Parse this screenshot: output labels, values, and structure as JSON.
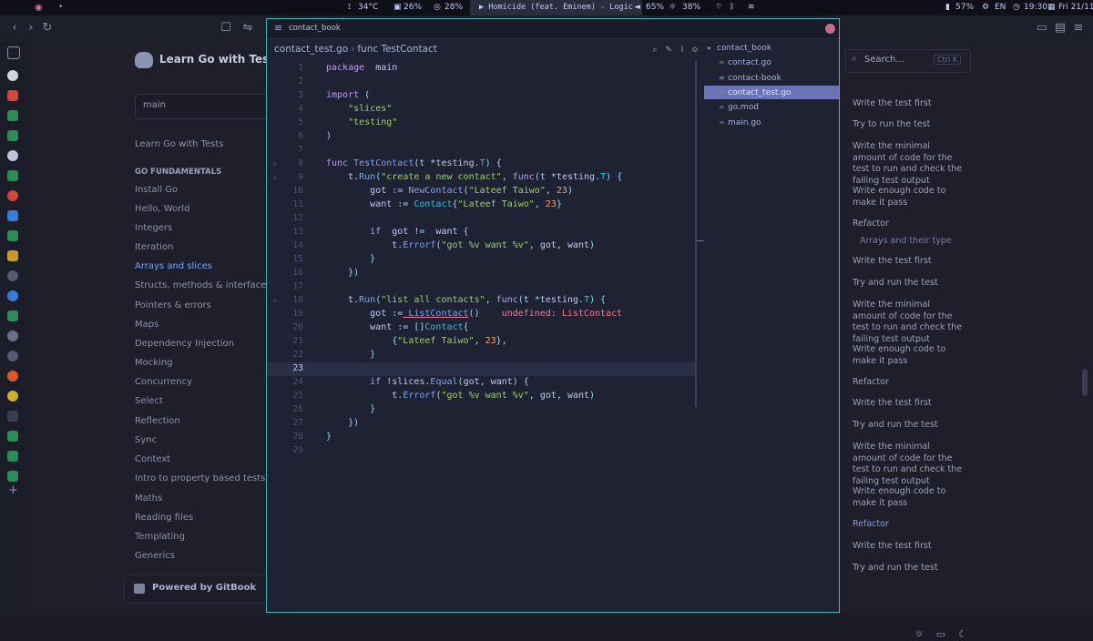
{
  "topbar": {
    "temperature": "34°C",
    "cpu": "26%",
    "memory": "28%",
    "now_playing": "▶ Homicide (feat. Eminem) - Logic",
    "volume": "65%",
    "brightness": "38%",
    "battery": "57%",
    "language": "EN",
    "time": "19:30",
    "date": "Fri 21/11"
  },
  "gitbook": {
    "site_title": "Learn Go with Tests",
    "search_value": "main",
    "nav": [
      {
        "label": "Learn Go with Tests",
        "kind": "item"
      },
      {
        "label": "GO FUNDAMENTALS",
        "kind": "section"
      },
      {
        "label": "Install Go",
        "kind": "item"
      },
      {
        "label": "Hello, World",
        "kind": "item"
      },
      {
        "label": "Integers",
        "kind": "item"
      },
      {
        "label": "Iteration",
        "kind": "item"
      },
      {
        "label": "Arrays and slices",
        "kind": "active"
      },
      {
        "label": "Structs, methods & interfaces",
        "kind": "item"
      },
      {
        "label": "Pointers & errors",
        "kind": "item"
      },
      {
        "label": "Maps",
        "kind": "item"
      },
      {
        "label": "Dependency Injection",
        "kind": "item"
      },
      {
        "label": "Mocking",
        "kind": "item"
      },
      {
        "label": "Concurrency",
        "kind": "item"
      },
      {
        "label": "Select",
        "kind": "item"
      },
      {
        "label": "Reflection",
        "kind": "item"
      },
      {
        "label": "Sync",
        "kind": "item"
      },
      {
        "label": "Context",
        "kind": "item"
      },
      {
        "label": "Intro to property based tests",
        "kind": "item"
      },
      {
        "label": "Maths",
        "kind": "item"
      },
      {
        "label": "Reading files",
        "kind": "item"
      },
      {
        "label": "Templating",
        "kind": "item"
      },
      {
        "label": "Generics",
        "kind": "item"
      }
    ],
    "powered_by": "Powered by GitBook",
    "toc_search_placeholder": "Search...",
    "toc_search_shortcut": "Ctrl K",
    "toc": [
      {
        "label": "Write the test first",
        "kind": "item"
      },
      {
        "label": "Try to run the test",
        "kind": "item"
      },
      {
        "label": "Write the minimal amount of code for the test to run and check the failing test output",
        "kind": "item"
      },
      {
        "label": "Write enough code to make it pass",
        "kind": "item"
      },
      {
        "label": "Refactor",
        "kind": "item"
      },
      {
        "label": "Arrays and their type",
        "kind": "sub"
      },
      {
        "label": "Write the test first",
        "kind": "item"
      },
      {
        "label": "Try and run the test",
        "kind": "item"
      },
      {
        "label": "Write the minimal amount of code for the test to run and check the failing test output",
        "kind": "item"
      },
      {
        "label": "Write enough code to make it pass",
        "kind": "item"
      },
      {
        "label": "Refactor",
        "kind": "item"
      },
      {
        "label": "Write the test first",
        "kind": "item"
      },
      {
        "label": "Try and run the test",
        "kind": "item"
      },
      {
        "label": "Write the minimal amount of code for the test to run and check the failing test output",
        "kind": "item"
      },
      {
        "label": "Write enough code to make it pass",
        "kind": "item"
      },
      {
        "label": "Refactor",
        "kind": "active"
      },
      {
        "label": "Write the test first",
        "kind": "item"
      },
      {
        "label": "Try and run the test",
        "kind": "item"
      }
    ]
  },
  "editor": {
    "window_title": "contact_book",
    "breadcrumb_file": "contact_test.go",
    "breadcrumb_symbol": "func TestContact",
    "current_line": 23,
    "lines": [
      {
        "n": 1,
        "tokens": [
          [
            "kw",
            "package"
          ],
          [
            "",
            "  main"
          ]
        ]
      },
      {
        "n": 2,
        "tokens": []
      },
      {
        "n": 3,
        "tokens": [
          [
            "kw",
            "import"
          ],
          [
            "pu",
            " ("
          ]
        ]
      },
      {
        "n": 4,
        "tokens": [
          [
            "",
            "    "
          ],
          [
            "st",
            "\"slices\""
          ]
        ]
      },
      {
        "n": 5,
        "tokens": [
          [
            "",
            "    "
          ],
          [
            "st",
            "\"testing\""
          ]
        ]
      },
      {
        "n": 6,
        "tokens": [
          [
            "pu",
            ")"
          ]
        ]
      },
      {
        "n": 7,
        "tokens": []
      },
      {
        "n": 8,
        "fold": true,
        "tokens": [
          [
            "kw",
            "func"
          ],
          [
            "fn",
            " TestContact"
          ],
          [
            "pu",
            "("
          ],
          [
            "",
            "t "
          ],
          [
            "pu",
            "*"
          ],
          [
            "",
            "testing"
          ],
          [
            "pu",
            "."
          ],
          [
            "ty",
            "T"
          ],
          [
            "pu",
            ") {"
          ]
        ]
      },
      {
        "n": 9,
        "fold": true,
        "tokens": [
          [
            "",
            "    t"
          ],
          [
            "pu",
            "."
          ],
          [
            "fn",
            "Run"
          ],
          [
            "pu",
            "("
          ],
          [
            "st",
            "\"create a new contact\""
          ],
          [
            "pu",
            ", "
          ],
          [
            "kw",
            "func"
          ],
          [
            "pu",
            "("
          ],
          [
            "",
            "t "
          ],
          [
            "pu",
            "*"
          ],
          [
            "",
            "testing"
          ],
          [
            "pu",
            "."
          ],
          [
            "ty",
            "T"
          ],
          [
            "pu",
            ") {"
          ]
        ]
      },
      {
        "n": 10,
        "tokens": [
          [
            "",
            "        got "
          ],
          [
            "pu",
            ":="
          ],
          [
            "fn",
            " NewContact"
          ],
          [
            "pu",
            "("
          ],
          [
            "st",
            "\"Lateef Taiwo\""
          ],
          [
            "pu",
            ", "
          ],
          [
            "nm",
            "23"
          ],
          [
            "pu",
            ")"
          ]
        ]
      },
      {
        "n": 11,
        "tokens": [
          [
            "",
            "        want "
          ],
          [
            "pu",
            ":="
          ],
          [
            "ty",
            " Contact"
          ],
          [
            "pu",
            "{"
          ],
          [
            "st",
            "\"Lateef Taiwo\""
          ],
          [
            "pu",
            ", "
          ],
          [
            "nm",
            "23"
          ],
          [
            "pu",
            "}"
          ]
        ]
      },
      {
        "n": 12,
        "tokens": []
      },
      {
        "n": 13,
        "tokens": [
          [
            "kw",
            "        if"
          ],
          [
            "",
            "  got "
          ],
          [
            "pu",
            "!="
          ],
          [
            "",
            "  want "
          ],
          [
            "pu",
            "{"
          ]
        ]
      },
      {
        "n": 14,
        "tokens": [
          [
            "",
            "            t"
          ],
          [
            "pu",
            "."
          ],
          [
            "fn",
            "Errorf"
          ],
          [
            "pu",
            "("
          ],
          [
            "st",
            "\"got %v want %v\""
          ],
          [
            "pu",
            ", "
          ],
          [
            "",
            "got"
          ],
          [
            "pu",
            ", "
          ],
          [
            "",
            "want"
          ],
          [
            "pu",
            ")"
          ]
        ]
      },
      {
        "n": 15,
        "tokens": [
          [
            "pu",
            "        }"
          ]
        ]
      },
      {
        "n": 16,
        "tokens": [
          [
            "pu",
            "    })"
          ]
        ]
      },
      {
        "n": 17,
        "tokens": []
      },
      {
        "n": 18,
        "fold": true,
        "tokens": [
          [
            "",
            "    t"
          ],
          [
            "pu",
            "."
          ],
          [
            "fn",
            "Run"
          ],
          [
            "pu",
            "("
          ],
          [
            "st",
            "\"list all contacts\""
          ],
          [
            "pu",
            ", "
          ],
          [
            "kw",
            "func"
          ],
          [
            "pu",
            "("
          ],
          [
            "",
            "t "
          ],
          [
            "pu",
            "*"
          ],
          [
            "",
            "testing"
          ],
          [
            "pu",
            "."
          ],
          [
            "ty",
            "T"
          ],
          [
            "pu",
            ") {"
          ]
        ]
      },
      {
        "n": 19,
        "tokens": [
          [
            "",
            "        got "
          ],
          [
            "pu",
            ":="
          ],
          [
            "fn und",
            " ListContact"
          ],
          [
            "pu",
            "()"
          ],
          [
            "",
            "    "
          ],
          [
            "err",
            "undefined: ListContact"
          ]
        ]
      },
      {
        "n": 20,
        "tokens": [
          [
            "",
            "        want "
          ],
          [
            "pu",
            ":= []"
          ],
          [
            "ty",
            "Contact"
          ],
          [
            "pu",
            "{"
          ]
        ]
      },
      {
        "n": 21,
        "tokens": [
          [
            "pu",
            "            {"
          ],
          [
            "st",
            "\"Lateef Taiwo\""
          ],
          [
            "pu",
            ", "
          ],
          [
            "nm",
            "23"
          ],
          [
            "pu",
            "},"
          ]
        ]
      },
      {
        "n": 22,
        "tokens": [
          [
            "pu",
            "        }"
          ]
        ]
      },
      {
        "n": 23,
        "tokens": []
      },
      {
        "n": 24,
        "tokens": [
          [
            "kw",
            "        if"
          ],
          [
            "pu",
            " !"
          ],
          [
            "",
            "slices"
          ],
          [
            "pu",
            "."
          ],
          [
            "fn",
            "Equal"
          ],
          [
            "pu",
            "("
          ],
          [
            "",
            "got"
          ],
          [
            "pu",
            ", "
          ],
          [
            "",
            "want"
          ],
          [
            "pu",
            ") {"
          ]
        ]
      },
      {
        "n": 25,
        "tokens": [
          [
            "",
            "            t"
          ],
          [
            "pu",
            "."
          ],
          [
            "fn",
            "Errorf"
          ],
          [
            "pu",
            "("
          ],
          [
            "st",
            "\"got %v want %v\""
          ],
          [
            "pu",
            ", "
          ],
          [
            "",
            "got"
          ],
          [
            "pu",
            ", "
          ],
          [
            "",
            "want"
          ],
          [
            "pu",
            ")"
          ]
        ]
      },
      {
        "n": 26,
        "tokens": [
          [
            "pu",
            "        }"
          ]
        ]
      },
      {
        "n": 27,
        "tokens": [
          [
            "pu",
            "    })"
          ]
        ]
      },
      {
        "n": 28,
        "tokens": [
          [
            "pu",
            "}"
          ]
        ]
      },
      {
        "n": 29,
        "tokens": []
      }
    ],
    "tree": [
      {
        "label": "contact_book",
        "icon": "folder-icon",
        "root": true
      },
      {
        "label": "contact.go",
        "icon": "go-file-icon"
      },
      {
        "label": "contact-book",
        "icon": "binary-file-icon"
      },
      {
        "label": "contact_test.go",
        "icon": "go-file-icon",
        "selected": true
      },
      {
        "label": "go.mod",
        "icon": "go-file-icon"
      },
      {
        "label": "main.go",
        "icon": "go-file-icon"
      }
    ]
  }
}
